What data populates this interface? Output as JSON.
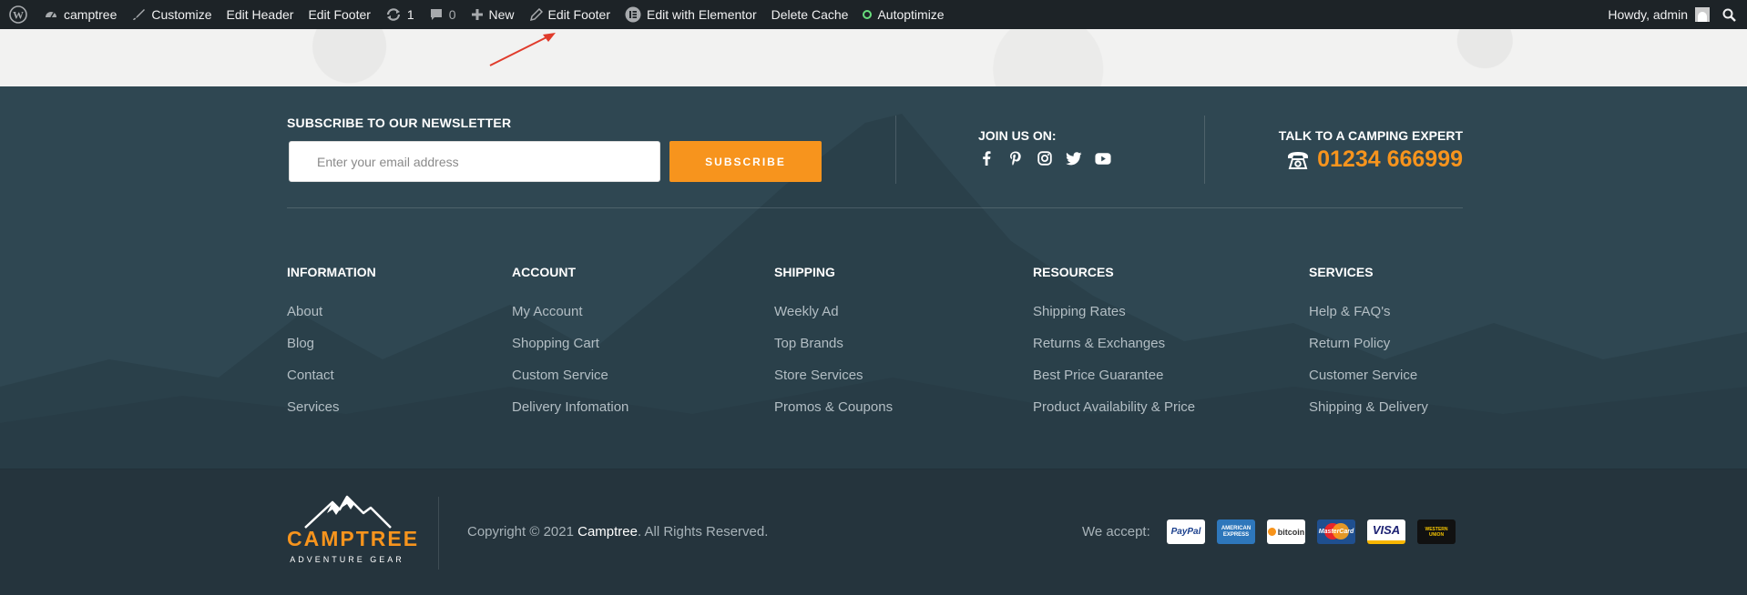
{
  "adminbar": {
    "site_name": "camptree",
    "customize": "Customize",
    "edit_header": "Edit Header",
    "edit_footer": "Edit Footer",
    "updates_count": "1",
    "comments_count": "0",
    "new": "New",
    "edit_footer_2": "Edit Footer",
    "edit_elementor": "Edit with Elementor",
    "delete_cache": "Delete Cache",
    "autoptimize": "Autoptimize",
    "howdy": "Howdy, admin"
  },
  "newsletter": {
    "heading": "SUBSCRIBE TO OUR NEWSLETTER",
    "placeholder": "Enter your email address",
    "button": "SUBSCRIBE"
  },
  "social": {
    "heading": "JOIN US ON:",
    "icons": [
      "facebook-icon",
      "pinterest-icon",
      "instagram-icon",
      "twitter-icon",
      "youtube-icon"
    ]
  },
  "contact": {
    "heading": "TALK TO A CAMPING EXPERT",
    "phone": "01234 666999"
  },
  "columns": [
    {
      "title": "INFORMATION",
      "links": [
        "About",
        "Blog",
        "Contact",
        "Services"
      ]
    },
    {
      "title": "ACCOUNT",
      "links": [
        "My Account",
        "Shopping Cart",
        "Custom Service",
        "Delivery Infomation"
      ]
    },
    {
      "title": "SHIPPING",
      "links": [
        "Weekly Ad",
        "Top Brands",
        "Store Services",
        "Promos & Coupons"
      ]
    },
    {
      "title": "RESOURCES",
      "links": [
        "Shipping Rates",
        "Returns & Exchanges",
        "Best Price Guarantee",
        "Product Availability & Price"
      ]
    },
    {
      "title": "SERVICES",
      "links": [
        "Help & FAQ's",
        "Return Policy",
        "Customer Service",
        "Shipping & Delivery"
      ]
    }
  ],
  "bottom": {
    "logo_name": "CAMPTREE",
    "logo_tag": "ADVENTURE GEAR",
    "copyright_prefix": "Copyright © 2021 ",
    "copyright_brand": "Camptree",
    "copyright_suffix": ". All Rights Reserved.",
    "we_accept": "We accept:",
    "cards": [
      "PayPal",
      "AMERICAN EXPRESS",
      "bitcoin",
      "MasterCard",
      "VISA",
      "WESTERN UNION"
    ]
  },
  "colors": {
    "accent": "#f7941d",
    "adminbar": "#1d2327",
    "footer_top": "#2f4752",
    "footer_bottom": "#25343d"
  }
}
